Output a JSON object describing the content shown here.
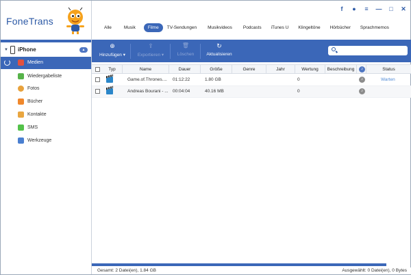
{
  "app": {
    "title": "FoneTrans"
  },
  "window_icons": [
    "facebook-icon",
    "chat-icon",
    "menu-icon",
    "minimize-icon",
    "maximize-icon",
    "close-icon"
  ],
  "window_glyphs": {
    "facebook": "f",
    "chat": "●",
    "menu": "≡",
    "minimize": "—",
    "maximize": "□",
    "close": "✕"
  },
  "sidebar": {
    "device": "iPhone",
    "items": [
      {
        "label": "Medien",
        "icon": "music-icon",
        "color": "#e2523f",
        "active": true
      },
      {
        "label": "Wiedergabeliste",
        "icon": "playlist-icon",
        "color": "#57b34a",
        "active": false
      },
      {
        "label": "Fotos",
        "icon": "photos-icon",
        "color": "#e8a23c",
        "active": false
      },
      {
        "label": "Bücher",
        "icon": "books-icon",
        "color": "#f0882c",
        "active": false
      },
      {
        "label": "Kontakte",
        "icon": "contacts-icon",
        "color": "#e9a640",
        "active": false
      },
      {
        "label": "SMS",
        "icon": "sms-icon",
        "color": "#54c24a",
        "active": false
      },
      {
        "label": "Werkzeuge",
        "icon": "tools-icon",
        "color": "#4a7fd0",
        "active": false
      }
    ]
  },
  "tabs": [
    "Alle",
    "Musik",
    "Filme",
    "TV-Sendungen",
    "Musikvideos",
    "Podcasts",
    "iTunes U",
    "Klingeltöne",
    "Hörbücher",
    "Sprachmemos"
  ],
  "active_tab": "Filme",
  "toolbar": {
    "add": {
      "label": "Hinzufügen",
      "glyph": "⊕"
    },
    "export": {
      "label": "Exportieren",
      "glyph": "⇪"
    },
    "delete": {
      "label": "Löschen",
      "glyph": "🗑"
    },
    "refresh": {
      "label": "Aktualisieren",
      "glyph": "↻"
    },
    "search_placeholder": ""
  },
  "table": {
    "columns": [
      "Typ",
      "Name",
      "Dauer",
      "Größe",
      "Genre",
      "Jahr",
      "Wertung",
      "Beschreibung",
      "Status"
    ],
    "rows": [
      {
        "name": "Game.of.Thrones....",
        "duration": "01:12:22",
        "size": "1.80 GB",
        "genre": "",
        "year": "",
        "rating": "0",
        "description": "",
        "status": "Warten"
      },
      {
        "name": "Andreas Bourani - ...",
        "duration": "00:04:04",
        "size": "40.16 MB",
        "genre": "",
        "year": "",
        "rating": "0",
        "description": "",
        "status": ""
      }
    ]
  },
  "statusbar": {
    "left": "Gesamt: 2 Datei(en), 1.84 GB",
    "right": "Ausgewählt: 0 Datei(en), 0 Bytes"
  }
}
